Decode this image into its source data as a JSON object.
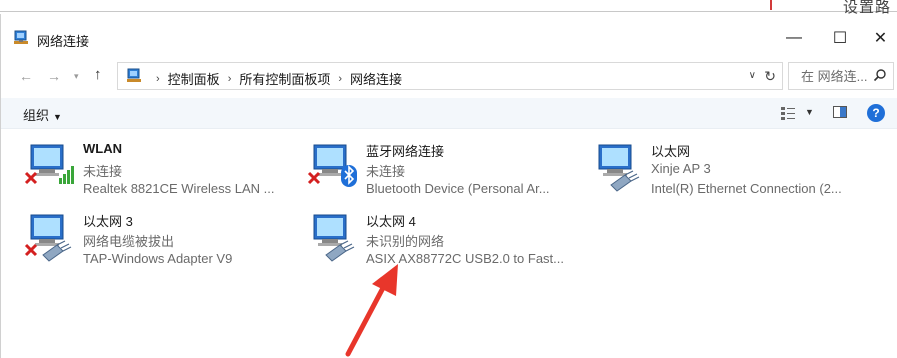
{
  "background_window": {
    "partial_text": "设置路"
  },
  "window": {
    "title": "网络连接",
    "controls": {
      "minimize": "—",
      "maximize": "☐",
      "close": "✕"
    }
  },
  "address_bar": {
    "breadcrumbs": [
      "控制面板",
      "所有控制面板项",
      "网络连接"
    ],
    "separator": "›"
  },
  "search": {
    "placeholder": "在 网络连..."
  },
  "command_bar": {
    "organize_label": "组织"
  },
  "connections": [
    {
      "name": "WLAN",
      "status": "未连接",
      "device": "Realtek 8821CE Wireless LAN ...",
      "type": "wifi",
      "state": "disconnected"
    },
    {
      "name": "蓝牙网络连接",
      "status": "未连接",
      "device": "Bluetooth Device (Personal Ar...",
      "type": "bluetooth",
      "state": "disconnected"
    },
    {
      "name": "以太网",
      "status": "Xinje AP 3",
      "device": "Intel(R) Ethernet Connection (2...",
      "type": "ethernet",
      "state": "connected"
    },
    {
      "name": "以太网 3",
      "status": "网络电缆被拔出",
      "device": "TAP-Windows Adapter V9",
      "type": "ethernet",
      "state": "disconnected"
    },
    {
      "name": "以太网 4",
      "status": "未识别的网络",
      "device": "ASIX AX88772C USB2.0 to Fast...",
      "type": "ethernet",
      "state": "connected"
    }
  ],
  "colors": {
    "accent": "#1f6fd8",
    "annotation_arrow": "#e8362b",
    "disconnected_x": "#d42020",
    "wifi_bars": "#3aa63a"
  }
}
